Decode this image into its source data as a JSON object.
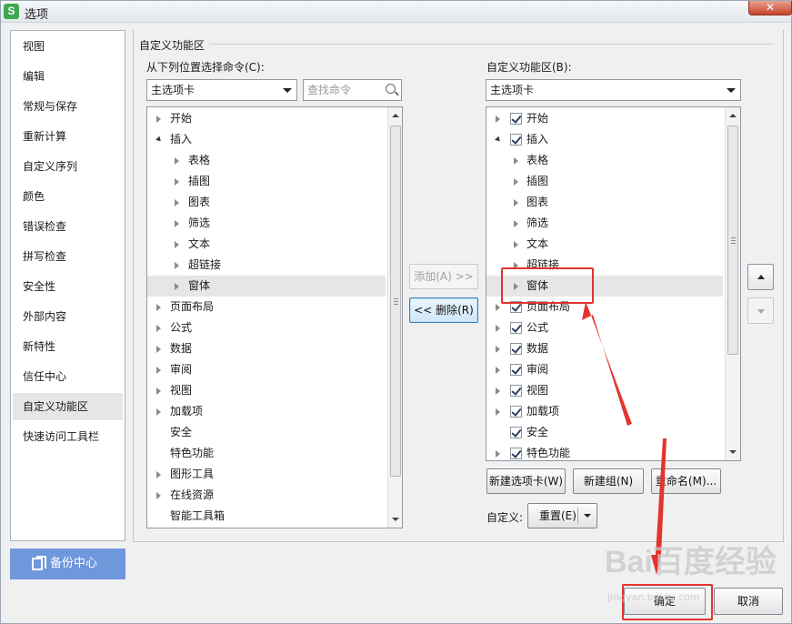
{
  "window": {
    "title": "选项",
    "app_icon_letter": "S",
    "close_glyph": "✕"
  },
  "nav": {
    "items": [
      {
        "label": "视图"
      },
      {
        "label": "编辑"
      },
      {
        "label": "常规与保存"
      },
      {
        "label": "重新计算"
      },
      {
        "label": "自定义序列"
      },
      {
        "label": "颜色"
      },
      {
        "label": "错误检查"
      },
      {
        "label": "拼写检查"
      },
      {
        "label": "安全性"
      },
      {
        "label": "外部内容"
      },
      {
        "label": "新特性"
      },
      {
        "label": "信任中心"
      },
      {
        "label": "自定义功能区"
      },
      {
        "label": "快速访问工具栏"
      }
    ],
    "active": "自定义功能区",
    "backup_label": "备份中心"
  },
  "customize": {
    "group_title": "自定义功能区",
    "left_label": "从下列位置选择命令(C):",
    "left_combo_value": "主选项卡",
    "search_placeholder": "查找命令",
    "right_label": "自定义功能区(B):",
    "right_combo_value": "主选项卡",
    "left_tree": [
      {
        "label": "开始",
        "level": 0,
        "expander": "collapsed"
      },
      {
        "label": "插入",
        "level": 0,
        "expander": "expanded"
      },
      {
        "label": "表格",
        "level": 1,
        "expander": "collapsed"
      },
      {
        "label": "插图",
        "level": 1,
        "expander": "collapsed"
      },
      {
        "label": "图表",
        "level": 1,
        "expander": "collapsed"
      },
      {
        "label": "筛选",
        "level": 1,
        "expander": "collapsed"
      },
      {
        "label": "文本",
        "level": 1,
        "expander": "collapsed"
      },
      {
        "label": "超链接",
        "level": 1,
        "expander": "collapsed"
      },
      {
        "label": "窗体",
        "level": 1,
        "expander": "collapsed",
        "selected": true
      },
      {
        "label": "页面布局",
        "level": 0,
        "expander": "collapsed"
      },
      {
        "label": "公式",
        "level": 0,
        "expander": "collapsed"
      },
      {
        "label": "数据",
        "level": 0,
        "expander": "collapsed"
      },
      {
        "label": "审阅",
        "level": 0,
        "expander": "collapsed"
      },
      {
        "label": "视图",
        "level": 0,
        "expander": "collapsed"
      },
      {
        "label": "加载项",
        "level": 0,
        "expander": "collapsed"
      },
      {
        "label": "安全",
        "level": 0,
        "expander": "none"
      },
      {
        "label": "特色功能",
        "level": 0,
        "expander": "none"
      },
      {
        "label": "图形工具",
        "level": 0,
        "expander": "collapsed"
      },
      {
        "label": "在线资源",
        "level": 0,
        "expander": "collapsed"
      },
      {
        "label": "智能工具箱",
        "level": 0,
        "expander": "none"
      }
    ],
    "right_tree": [
      {
        "label": "开始",
        "level": 0,
        "expander": "collapsed",
        "checked": true
      },
      {
        "label": "插入",
        "level": 0,
        "expander": "expanded",
        "checked": true
      },
      {
        "label": "表格",
        "level": 1,
        "expander": "collapsed"
      },
      {
        "label": "插图",
        "level": 1,
        "expander": "collapsed"
      },
      {
        "label": "图表",
        "level": 1,
        "expander": "collapsed"
      },
      {
        "label": "筛选",
        "level": 1,
        "expander": "collapsed"
      },
      {
        "label": "文本",
        "level": 1,
        "expander": "collapsed"
      },
      {
        "label": "超链接",
        "level": 1,
        "expander": "collapsed"
      },
      {
        "label": "窗体",
        "level": 1,
        "expander": "collapsed",
        "selected": true
      },
      {
        "label": "页面布局",
        "level": 0,
        "expander": "collapsed",
        "checked": true
      },
      {
        "label": "公式",
        "level": 0,
        "expander": "collapsed",
        "checked": true
      },
      {
        "label": "数据",
        "level": 0,
        "expander": "collapsed",
        "checked": true
      },
      {
        "label": "审阅",
        "level": 0,
        "expander": "collapsed",
        "checked": true
      },
      {
        "label": "视图",
        "level": 0,
        "expander": "collapsed",
        "checked": true
      },
      {
        "label": "加载项",
        "level": 0,
        "expander": "collapsed",
        "checked": true
      },
      {
        "label": "安全",
        "level": 0,
        "expander": "none",
        "checked": true
      },
      {
        "label": "特色功能",
        "level": 0,
        "expander": "collapsed",
        "checked": true
      }
    ],
    "add_button": "添加(A) >>",
    "remove_button": "<< 删除(R)",
    "new_tab_button": "新建选项卡(W)",
    "new_group_button": "新建组(N)",
    "rename_button": "重命名(M)...",
    "custom_label": "自定义:",
    "reset_button": "重置(E)"
  },
  "footer": {
    "ok_button": "确定",
    "cancel_button": "取消"
  },
  "watermark": {
    "logo": "Bai百度经验",
    "sub": "jingyan.baidu.com"
  },
  "colors": {
    "accent_blue": "#6e97dc",
    "annotation_red": "#e3342f",
    "selection_gray": "#e6e6e6"
  }
}
